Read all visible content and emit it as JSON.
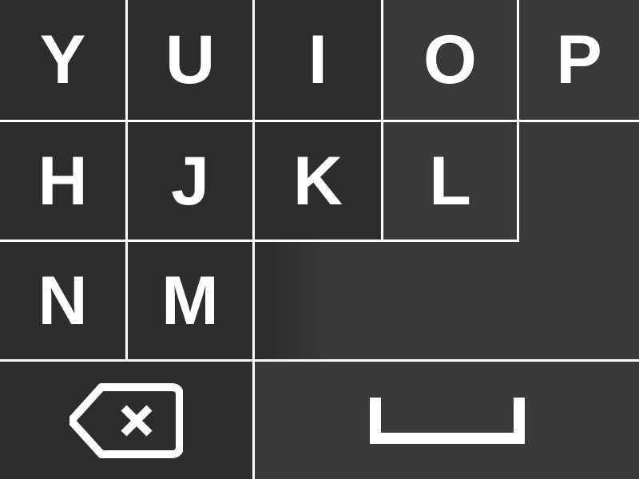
{
  "keyboard": {
    "rows": [
      {
        "keys": [
          "Y",
          "U",
          "I",
          "O",
          "P"
        ]
      },
      {
        "keys": [
          "H",
          "J",
          "K",
          "L"
        ]
      },
      {
        "keys": [
          "N",
          "M"
        ]
      }
    ],
    "bottom_row": {
      "backspace_icon": "backspace-icon",
      "space_icon": "space-bar-icon"
    },
    "colors": {
      "key_text": "#ffffff",
      "grid_lines": "#ffffff",
      "key_dark": "#2d2d2d",
      "key_light": "#393939"
    }
  }
}
